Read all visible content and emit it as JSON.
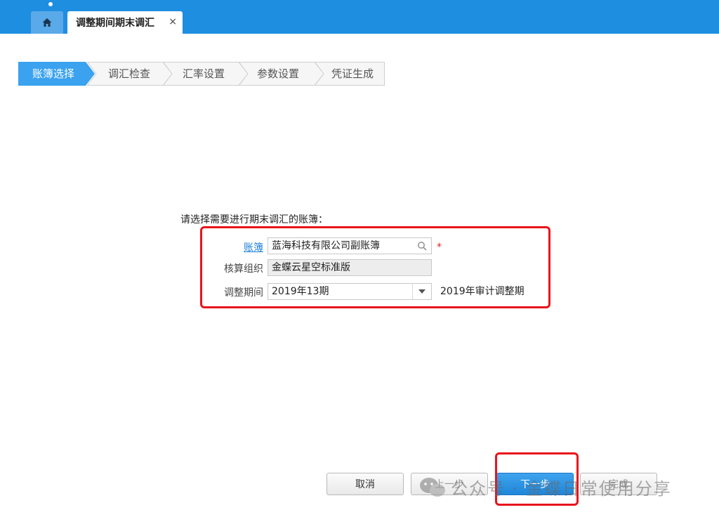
{
  "tabs": {
    "active_title": "调整期间期末调汇",
    "close_glyph": "×"
  },
  "steps": [
    {
      "label": "账簿选择",
      "active": true
    },
    {
      "label": "调汇检查",
      "active": false
    },
    {
      "label": "汇率设置",
      "active": false
    },
    {
      "label": "参数设置",
      "active": false
    },
    {
      "label": "凭证生成",
      "active": false
    }
  ],
  "form": {
    "prompt": "请选择需要进行期末调汇的账簿：",
    "book_label": "账簿",
    "book_value": "蓝海科技有限公司副账簿",
    "required_mark": "*",
    "org_label": "核算组织",
    "org_value": "金蝶云星空标准版",
    "period_label": "调整期间",
    "period_value": "2019年13期",
    "period_note": "2019年审计调整期"
  },
  "buttons": {
    "cancel": "取消",
    "prev": "上一步",
    "next": "下一步",
    "finish": "完成"
  },
  "watermark": {
    "text": "公众号 · 金蝶日常使用分享"
  },
  "colors": {
    "accent": "#1e8ee0",
    "highlight": "#e8141c",
    "active_step": "#3aa2ef"
  }
}
